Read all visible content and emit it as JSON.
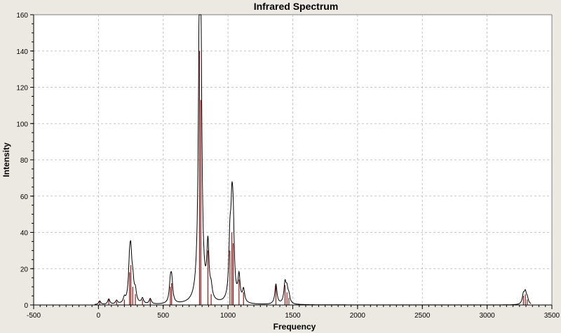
{
  "chart_data": {
    "type": "line",
    "title": "Infrared Spectrum",
    "xlabel": "Frequency",
    "ylabel": "Intensity",
    "xlim": [
      -500,
      3500
    ],
    "ylim": [
      0,
      160
    ],
    "x_ticks": [
      -500,
      0,
      500,
      1000,
      1500,
      2000,
      2500,
      3000,
      3500
    ],
    "y_ticks": [
      0,
      20,
      40,
      60,
      80,
      100,
      120,
      140,
      160
    ],
    "grid": true,
    "plot_background": "#ffffff",
    "background": "#ebe9e2",
    "spectrum_color": "#000000",
    "stick_color": "#8b1a1a",
    "spectrum_range": [
      -30,
      3340
    ],
    "peak_width": 10,
    "series": [
      {
        "kind": "sticks",
        "x": [
          10,
          80,
          140,
          200,
          240,
          250,
          265,
          285,
          340,
          400,
          555,
          565,
          780,
          790,
          845,
          870,
          1015,
          1030,
          1040,
          1085,
          1120,
          1370,
          1440,
          1455,
          1470,
          3280,
          3295,
          3310
        ],
        "values": [
          2,
          3,
          2,
          3,
          18,
          22,
          10,
          6,
          3,
          3,
          10,
          12,
          140,
          113,
          30,
          6,
          30,
          40,
          34,
          14,
          7,
          11,
          11,
          7,
          4,
          5,
          6,
          3
        ]
      }
    ]
  }
}
